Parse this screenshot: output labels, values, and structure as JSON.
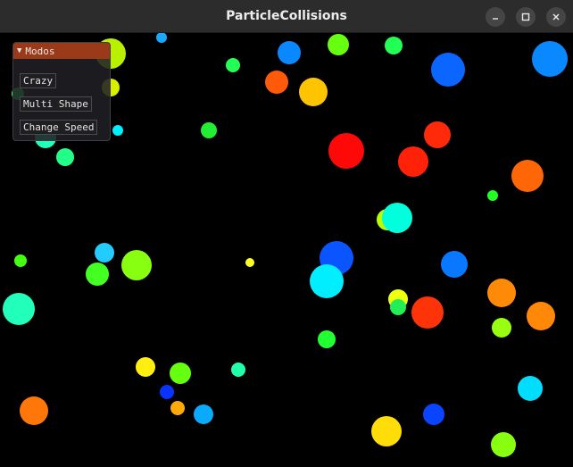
{
  "window": {
    "title": "ParticleCollisions",
    "minimize_icon": "minimize-icon",
    "maximize_icon": "maximize-icon",
    "close_icon": "close-icon"
  },
  "panel": {
    "header": "Modos",
    "collapse_icon": "triangle-down-icon",
    "buttons": [
      "Crazy",
      "Multi Shape",
      "Change Speed"
    ]
  },
  "colors": {
    "panel_header": "#9b3a18",
    "background": "#000000"
  }
}
